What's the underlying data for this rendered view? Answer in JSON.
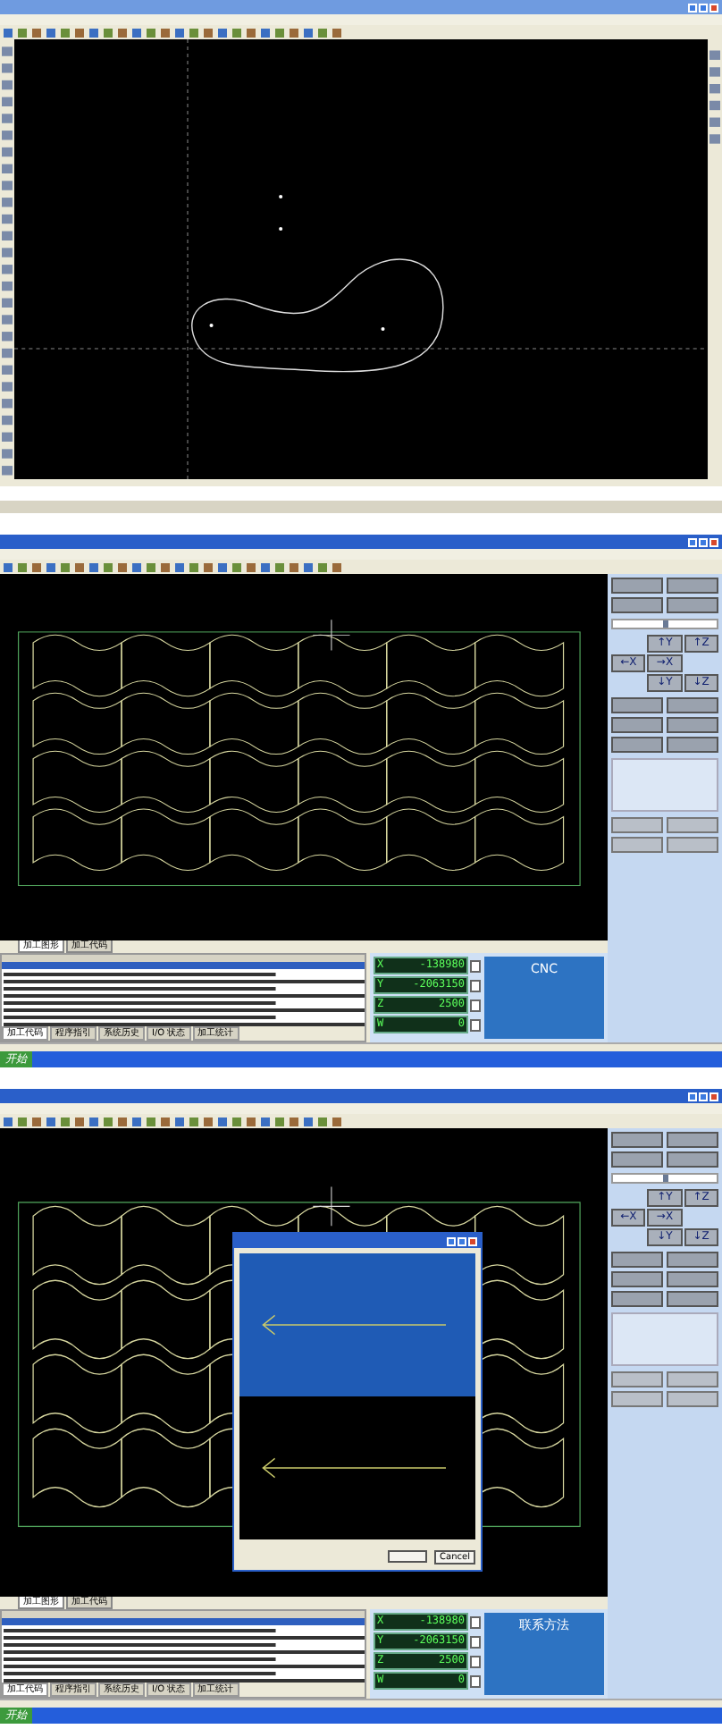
{
  "screens": [
    {
      "kind": "cad"
    },
    {
      "kind": "cnc",
      "info_lines": [
        "CNC"
      ],
      "speed": {
        "level": 0.5
      },
      "canvas_tabs": [
        {
          "label": "加工图形",
          "selected": true
        },
        {
          "label": "加工代码",
          "selected": false
        }
      ],
      "bottom_tabs": [
        {
          "label": "加工代码",
          "selected": true
        },
        {
          "label": "程序指引",
          "selected": false
        },
        {
          "label": "系统历史",
          "selected": false
        },
        {
          "label": "I/O 状态",
          "selected": false
        },
        {
          "label": "加工统计",
          "selected": false
        }
      ],
      "readouts": [
        {
          "axis": "X",
          "value": "-138980"
        },
        {
          "axis": "Y",
          "value": "-2063150"
        },
        {
          "axis": "Z",
          "value": "2500"
        },
        {
          "axis": "W",
          "value": "0"
        }
      ],
      "jog": [
        "↑Y",
        "←X",
        "→X",
        "↓Y",
        "↑Z",
        "↓Z"
      ],
      "taskbar": {
        "start": "开始"
      }
    },
    {
      "kind": "cnc",
      "info_lines": [
        "联系方法"
      ],
      "dialog": {
        "cancel": "Cancel"
      },
      "speed": {
        "level": 0.5
      },
      "canvas_tabs": [
        {
          "label": "加工图形",
          "selected": true
        },
        {
          "label": "加工代码",
          "selected": false
        }
      ],
      "bottom_tabs": [
        {
          "label": "加工代码",
          "selected": true
        },
        {
          "label": "程序指引",
          "selected": false
        },
        {
          "label": "系统历史",
          "selected": false
        },
        {
          "label": "I/O 状态",
          "selected": false
        },
        {
          "label": "加工统计",
          "selected": false
        }
      ],
      "readouts": [
        {
          "axis": "X",
          "value": "-138980"
        },
        {
          "axis": "Y",
          "value": "-2063150"
        },
        {
          "axis": "Z",
          "value": "2500"
        },
        {
          "axis": "W",
          "value": "0"
        }
      ],
      "jog": [
        "↑Y",
        "←X",
        "→X",
        "↓Y",
        "↑Z",
        "↓Z"
      ],
      "taskbar": {
        "start": "开始"
      }
    }
  ]
}
